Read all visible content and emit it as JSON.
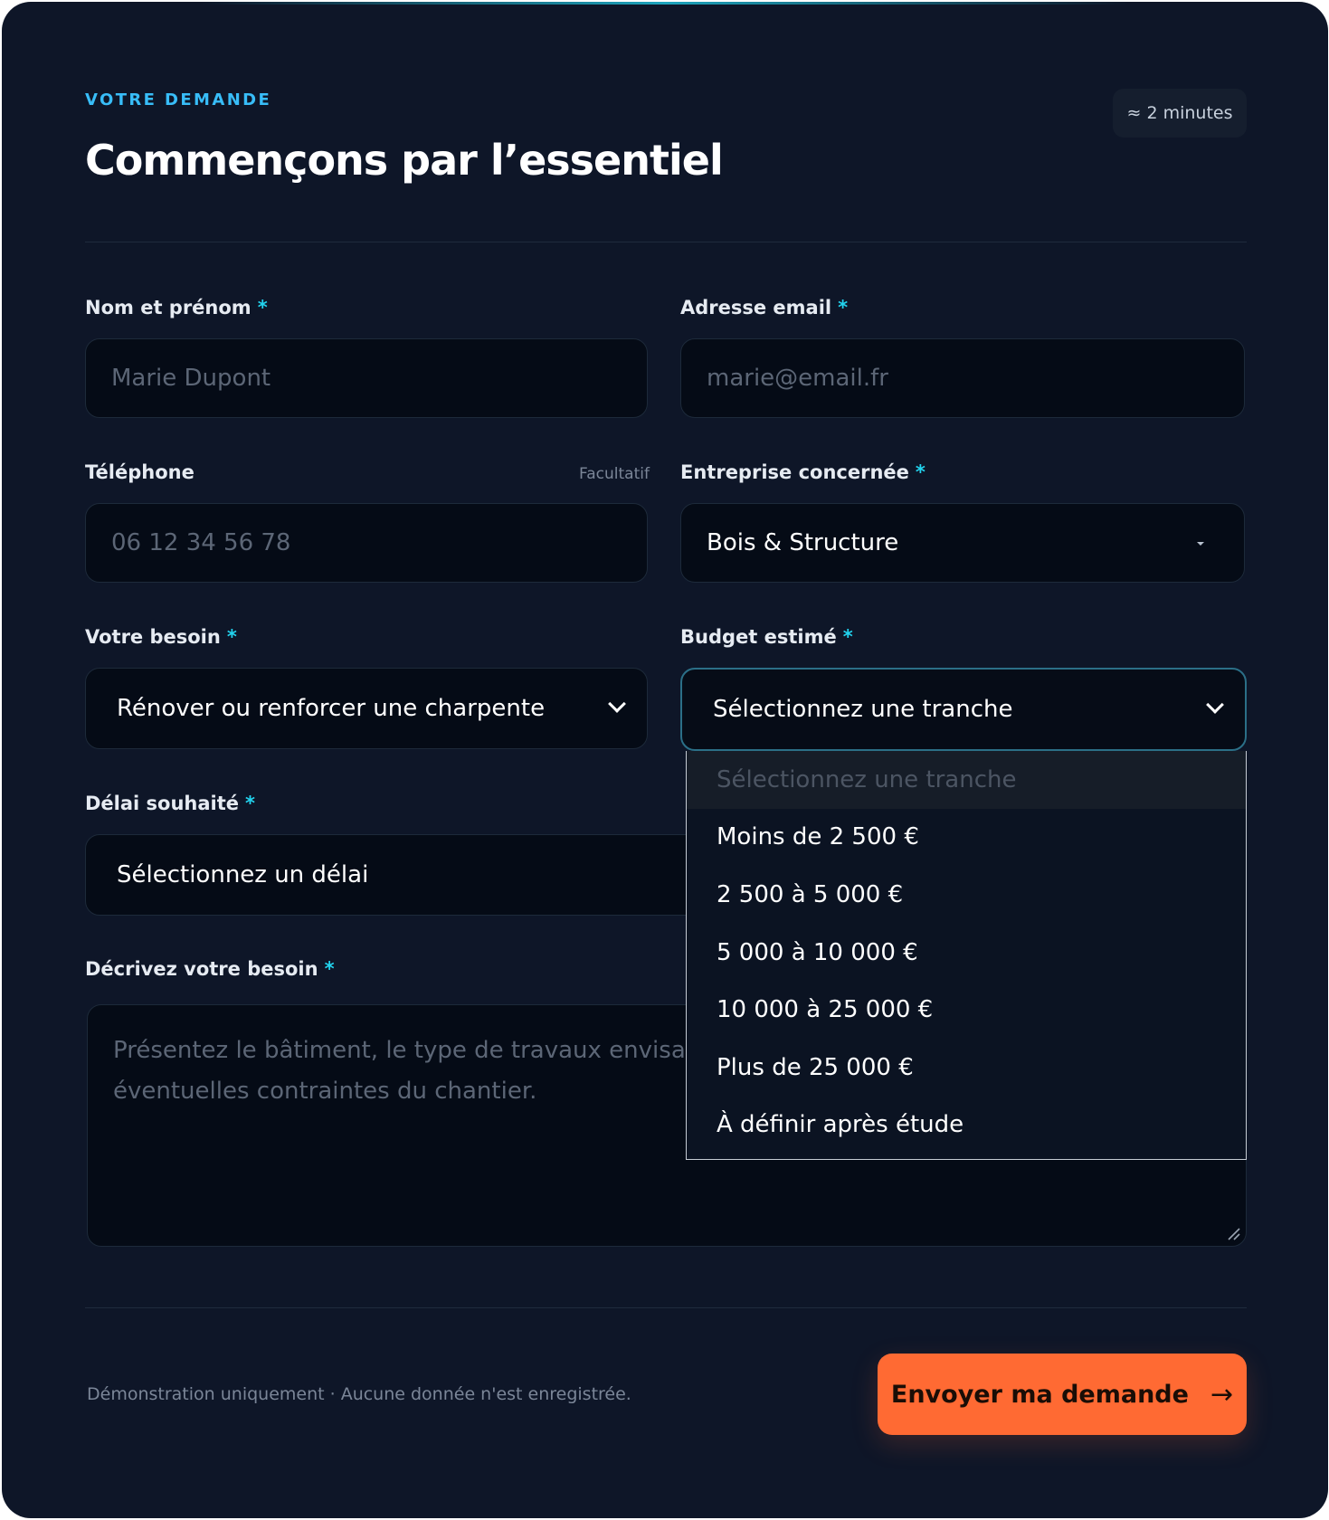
{
  "form": {
    "eyebrow": "VOTRE DEMANDE",
    "title": "Commençons par l’essentiel",
    "duration_badge": "≈ 2 minutes",
    "required_marker": "*",
    "fields": {
      "name": {
        "label": "Nom et prénom",
        "placeholder": "Marie Dupont"
      },
      "email": {
        "label": "Adresse email",
        "placeholder": "marie@email.fr"
      },
      "phone": {
        "label": "Téléphone",
        "optional_label": "Facultatif",
        "placeholder": "06 12 34 56 78"
      },
      "company": {
        "label": "Entreprise concernée",
        "value": "Bois & Structure"
      },
      "need": {
        "label": "Votre besoin",
        "value": "Rénover ou renforcer une charpente"
      },
      "budget": {
        "label": "Budget estimé",
        "value": "Sélectionnez une tranche"
      },
      "deadline": {
        "label": "Délai souhaité",
        "value": "Sélectionnez un délai"
      },
      "description": {
        "label": "Décrivez votre besoin",
        "placeholder_line1": "Présentez le bâtiment, le type de travaux envisagé,",
        "placeholder_line2": "éventuelles contraintes du chantier."
      }
    },
    "budget_dropdown": {
      "placeholder": "Sélectionnez une tranche",
      "options": [
        "Moins de 2 500 €",
        "2 500 à 5 000 €",
        "5 000 à 10 000 €",
        "10 000 à 25 000 €",
        "Plus de 25 000 €",
        "À définir après étude"
      ]
    },
    "footer_note": "Démonstration uniquement · Aucune donnée n'est enregistrée.",
    "submit_label": "Envoyer ma demande",
    "submit_arrow": "→"
  },
  "colors": {
    "accent": "#22d3ee",
    "eyebrow": "#38bdf8",
    "button": "#ff6a33",
    "background": "#0e1628",
    "field_background": "#050b16"
  }
}
